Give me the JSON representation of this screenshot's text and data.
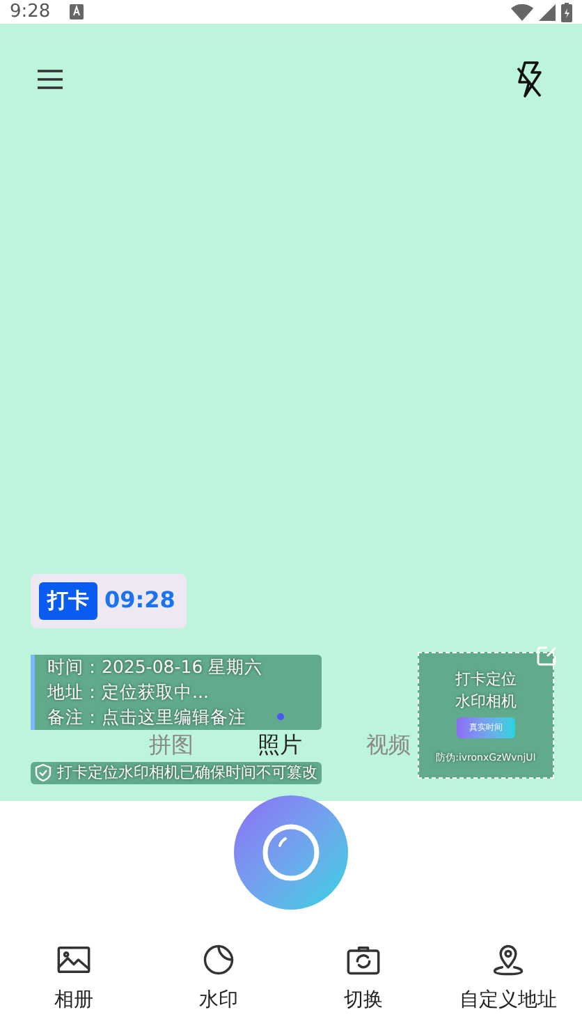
{
  "status_bar": {
    "time": "9:28"
  },
  "watermark": {
    "badge": "打卡",
    "time": "09:28",
    "lines": [
      "时间：2025-08-16 星期六",
      "地址：定位获取中...",
      "备注：点击这里编辑备注"
    ],
    "guarantee": "打卡定位水印相机已确保时间不可篡改"
  },
  "stamp": {
    "title_lines": [
      "打卡定位",
      "水印相机"
    ],
    "button": "真实时间",
    "code": "防伪:ivronxGzWvnjUI"
  },
  "modes": [
    {
      "label": "拼图",
      "selected": false
    },
    {
      "label": "照片",
      "selected": true
    },
    {
      "label": "视频",
      "selected": false
    }
  ],
  "toolbar": [
    {
      "kind": "album",
      "label": "相册"
    },
    {
      "kind": "watermark",
      "label": "水印"
    },
    {
      "kind": "switch",
      "label": "切换"
    },
    {
      "kind": "location",
      "label": "自定义地址"
    }
  ]
}
